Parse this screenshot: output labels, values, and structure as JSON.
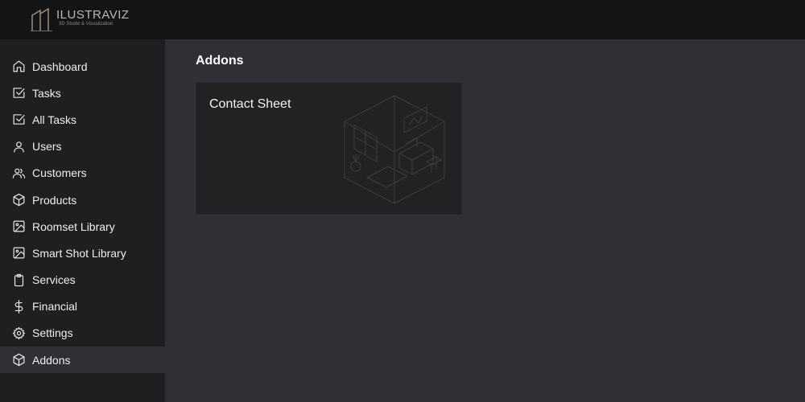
{
  "brand": {
    "name": "ILUSTRAVIZ",
    "tagline": "3D Studio & Visualization"
  },
  "sidebar": {
    "items": [
      {
        "label": "Dashboard",
        "icon": "home-icon",
        "active": false
      },
      {
        "label": "Tasks",
        "icon": "check-square-icon",
        "active": false
      },
      {
        "label": "All Tasks",
        "icon": "check-square-icon",
        "active": false
      },
      {
        "label": "Users",
        "icon": "user-icon",
        "active": false
      },
      {
        "label": "Customers",
        "icon": "users-icon",
        "active": false
      },
      {
        "label": "Products",
        "icon": "box-icon",
        "active": false
      },
      {
        "label": "Roomset Library",
        "icon": "image-icon",
        "active": false
      },
      {
        "label": "Smart Shot Library",
        "icon": "image-icon",
        "active": false
      },
      {
        "label": "Services",
        "icon": "clipboard-icon",
        "active": false
      },
      {
        "label": "Financial",
        "icon": "dollar-icon",
        "active": false
      },
      {
        "label": "Settings",
        "icon": "gear-icon",
        "active": false
      },
      {
        "label": "Addons",
        "icon": "box-icon",
        "active": true
      }
    ]
  },
  "main": {
    "title": "Addons",
    "cards": [
      {
        "title": "Contact Sheet",
        "illustration": "isometric-room-icon"
      }
    ]
  },
  "colors": {
    "topbar": "#141416",
    "sidebar": "#1f1f22",
    "main": "#2f2f35",
    "card": "#222224",
    "active_item": "#2f2f35"
  }
}
